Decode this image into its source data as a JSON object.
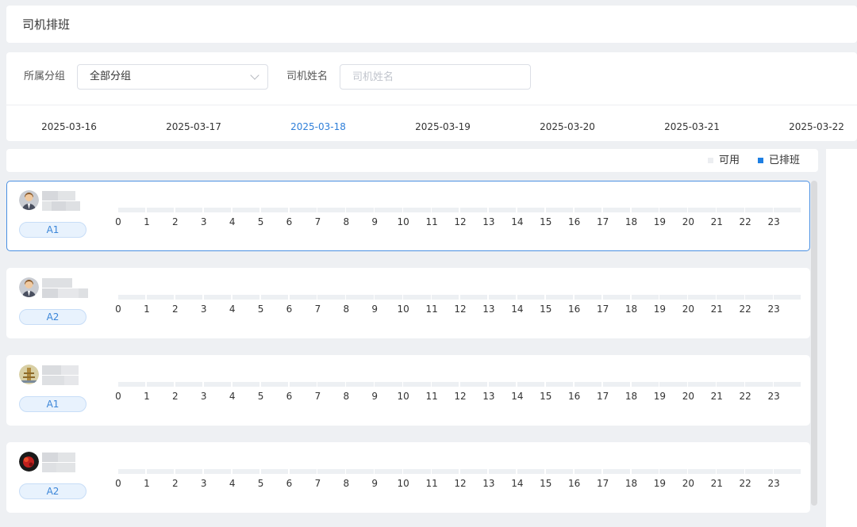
{
  "page": {
    "title": "司机排班"
  },
  "filters": {
    "group_label": "所属分组",
    "group_value": "全部分组",
    "name_label": "司机姓名",
    "name_placeholder": "司机姓名",
    "name_value": ""
  },
  "date_tabs": [
    "2025-03-16",
    "2025-03-17",
    "2025-03-18",
    "2025-03-19",
    "2025-03-20",
    "2025-03-21",
    "2025-03-22"
  ],
  "active_tab": "2025-03-18",
  "legend": {
    "available": {
      "label": "可用",
      "color": "#eceef1"
    },
    "scheduled": {
      "label": "已排班",
      "color": "#1e7fe3"
    }
  },
  "hours": [
    "0",
    "1",
    "2",
    "3",
    "4",
    "5",
    "6",
    "7",
    "8",
    "9",
    "10",
    "11",
    "12",
    "13",
    "14",
    "15",
    "16",
    "17",
    "18",
    "19",
    "20",
    "21",
    "22",
    "23"
  ],
  "drivers": [
    {
      "group": "A1",
      "avatar": "driver-avatar-icon",
      "selected": true
    },
    {
      "group": "A2",
      "avatar": "driver-avatar-icon",
      "selected": false
    },
    {
      "group": "A1",
      "avatar": "driver-avatar-icon",
      "selected": false
    },
    {
      "group": "A2",
      "avatar": "driver-avatar-icon",
      "selected": false
    }
  ]
}
